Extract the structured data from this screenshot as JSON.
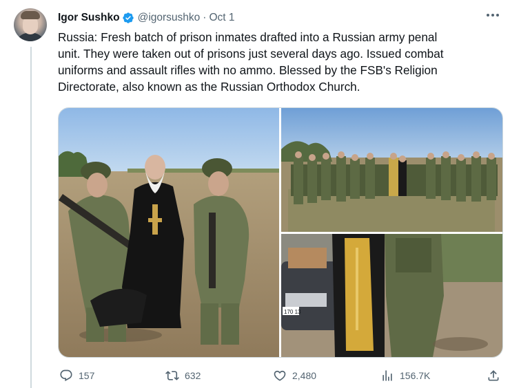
{
  "author": {
    "display_name": "Igor Sushko",
    "handle": "@igorsushko",
    "separator": "·",
    "date": "Oct 1",
    "verified": true,
    "avatar_icon": "profile-photo"
  },
  "tweet": {
    "lines": [
      "Russia: Fresh batch of prison inmates drafted into a Russian army penal",
      "unit. They were taken out of prisons just several days ago. Issued combat",
      "uniforms and assault rifles with no ammo. Blessed by the FSB's Religion",
      "Directorate, also known as the Russian Orthodox Church."
    ]
  },
  "media": {
    "photos": [
      {
        "subject": "two-soldiers-with-priest"
      },
      {
        "subject": "group-of-soldiers-in-field"
      },
      {
        "subject": "priest-beside-soldier-and-car",
        "plate_text": "170 13"
      }
    ]
  },
  "actions": {
    "reply_count": "157",
    "retweet_count": "632",
    "like_count": "2,480",
    "view_count": "156.7K"
  },
  "colors": {
    "text_primary": "#0f1419",
    "text_secondary": "#536471",
    "verified_blue": "#1d9bf0",
    "border": "#cfd9de"
  }
}
